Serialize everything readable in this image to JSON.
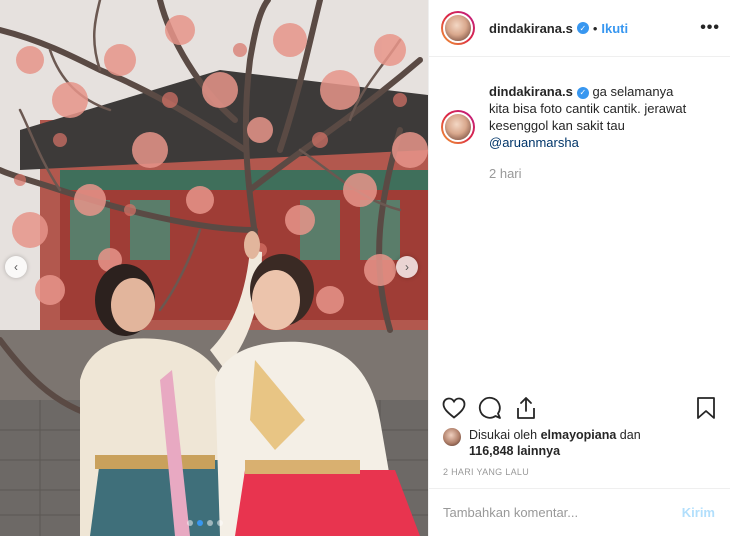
{
  "post": {
    "username": "dindakirana.s",
    "follow_label": "Ikuti",
    "separator": "•",
    "more_glyph": "•••",
    "caption": "ga selamanya kita bisa foto cantik cantik. jerawat kesenggol kan sakit tau",
    "mention": "@aruanmarsha",
    "relative_time": "2 hari",
    "likes": {
      "prefix": "Disukai oleh",
      "liker": "elmayopiana",
      "connector": "dan",
      "others": "116,848 lainnya"
    },
    "posted_ago": "2 HARI YANG LALU",
    "comment_placeholder": "Tambahkan komentar...",
    "send_label": "Kirim"
  },
  "carousel": {
    "prev_glyph": "‹",
    "next_glyph": "›",
    "slide_count": 4,
    "active_slide": 2
  },
  "colors": {
    "accent": "#3897f0",
    "send_disabled": "#b2dffc",
    "blossom": "#e7958a"
  }
}
